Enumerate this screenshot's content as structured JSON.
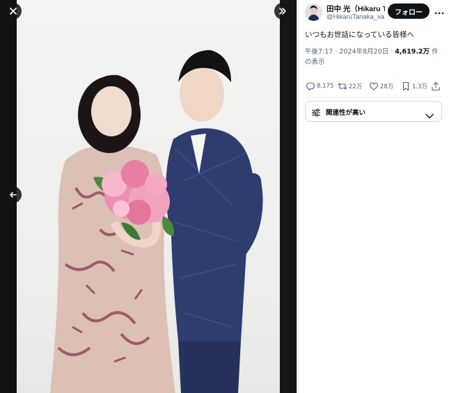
{
  "viewer": {
    "close_icon": "close-icon",
    "next_icon": "chevrons-right-icon",
    "prev_icon": "arrow-left-icon"
  },
  "tweet": {
    "display_name": "田中 光（Hikaru Ta",
    "handle": "@HikaruTanaka_va",
    "follow_label": "フォロー",
    "text": "いつもお世話になっている皆様へ",
    "time": "午後7:17 · 2024年8月20日 · ",
    "views": "4,619.2万",
    "views_suffix": " 件の表示"
  },
  "stats": {
    "replies": "8,175",
    "reposts": "22万",
    "likes": "28万",
    "bookmarks": "1.3万"
  },
  "sort": {
    "label": "関連性が高い"
  },
  "colors": {
    "text_primary": "#0f1419",
    "text_secondary": "#536471",
    "follow_bg": "#0f1419",
    "border": "#cfd9de"
  }
}
